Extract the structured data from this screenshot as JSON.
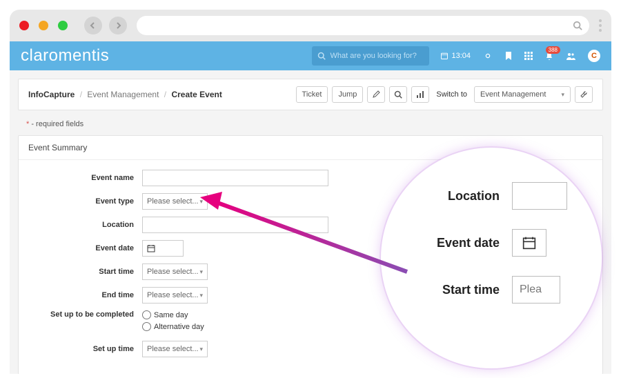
{
  "brand": "claromentis",
  "header_search_placeholder": "What are you looking for?",
  "header": {
    "time": "13:04",
    "notification_count": "388"
  },
  "breadcrumb": {
    "root": "InfoCapture",
    "mid": "Event Management",
    "leaf": "Create Event"
  },
  "toolbar": {
    "ticket": "Ticket",
    "jump": "Jump",
    "switch_to": "Switch to",
    "project_select": "Event Management"
  },
  "required_note_label": " - required fields",
  "panel_title": "Event Summary",
  "form": {
    "event_name_label": "Event name",
    "event_type_label": "Event type",
    "event_type_value": "Please select...",
    "location_label": "Location",
    "event_date_label": "Event date",
    "start_time_label": "Start time",
    "start_time_value": "Please select...",
    "end_time_label": "End time",
    "end_time_value": "Please select...",
    "setup_completed_label": "Set up to be completed",
    "setup_same_day": "Same day",
    "setup_alt_day": "Alternative day",
    "setup_time_label": "Set up time",
    "setup_time_value": "Please select..."
  },
  "zoom": {
    "location_label": "Location",
    "event_date_label": "Event date",
    "start_time_label": "Start time",
    "start_time_value": "Plea"
  }
}
